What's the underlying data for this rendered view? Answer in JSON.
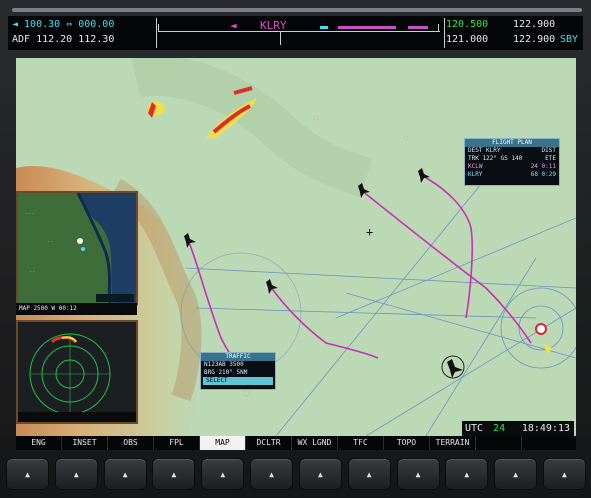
{
  "header": {
    "left_line1": "◄ 100.30  ⇔ 000.00",
    "left_line2": "ADF 112.20   112.30",
    "center_arrow": "◄",
    "center_id": "KLRY",
    "right_active_green": "120.500",
    "right_standby_1": "122.900",
    "right_line2_active": "121.000",
    "right_line2_standby": "122.900",
    "right_line2_tag": "SBY"
  },
  "map": {
    "center_crosshair": "+",
    "popup_upper": {
      "title": "FLIGHT PLAN",
      "rows": [
        {
          "left": "DEST KLRY",
          "right": "DIST"
        },
        {
          "left": "TRK 122°  GS 140",
          "right": "ETE"
        },
        {
          "left": "KCLW",
          "right": "24   0:11"
        },
        {
          "left": "KLRY",
          "right": "68   0:29"
        }
      ]
    },
    "popup_lower": {
      "title": "TRAFFIC",
      "rows": [
        {
          "left": "N123AB  3500",
          "right": ""
        },
        {
          "left": "BRG 210°  5NM",
          "right": ""
        },
        {
          "left": "SELECT",
          "right": ""
        }
      ]
    },
    "inset_bottom_label": "MAP 2500 W 00:12"
  },
  "status": {
    "left": "UTC",
    "value_green": "24",
    "time": "18:49:13"
  },
  "softkeys": [
    "ENG",
    "INSET",
    "OBS",
    "FPL",
    "MAP",
    "DCLTR",
    "WX LGND",
    "TFC",
    "TOPO",
    "TERRAIN",
    "",
    ""
  ],
  "softkey_active_index": 4,
  "hardware_buttons": [
    "▲",
    "▲",
    "▲",
    "▲",
    "▲",
    "▲",
    "▲",
    "▲",
    "▲",
    "▲",
    "▲",
    "▲"
  ]
}
